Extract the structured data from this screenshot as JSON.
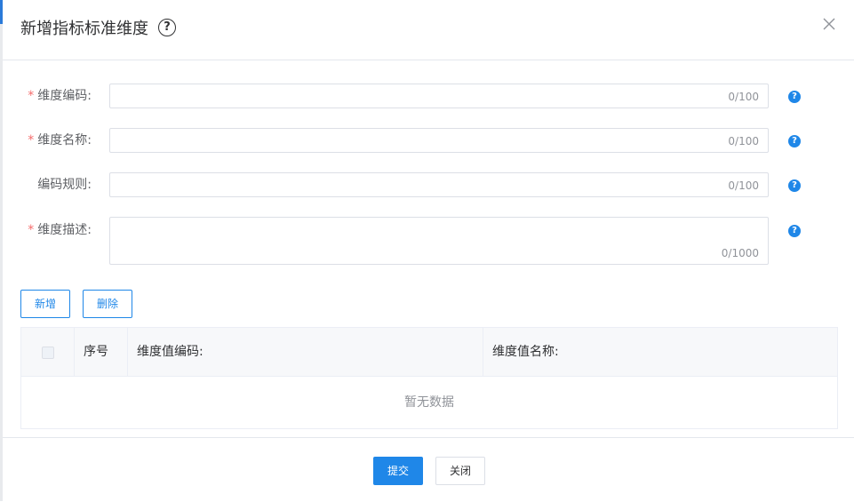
{
  "dialog": {
    "title": "新增指标标准维度",
    "help_glyph": "?",
    "close_icon": "close-icon"
  },
  "form": {
    "fields": [
      {
        "label": "维度编码:",
        "required": true,
        "counter": "0/100"
      },
      {
        "label": "维度名称:",
        "required": true,
        "counter": "0/100"
      },
      {
        "label": "编码规则:",
        "required": false,
        "counter": "0/100"
      },
      {
        "label": "维度描述:",
        "required": true,
        "counter": "0/1000"
      }
    ],
    "required_mark": "*",
    "help_glyph": "?"
  },
  "toolbar": {
    "add_label": "新增",
    "delete_label": "删除"
  },
  "table": {
    "columns": [
      "序号",
      "维度值编码:",
      "维度值名称:"
    ],
    "empty_text": "暂无数据"
  },
  "footer": {
    "submit_label": "提交",
    "close_label": "关闭"
  },
  "colors": {
    "primary": "#1f87e8",
    "required": "#f56c6c"
  }
}
